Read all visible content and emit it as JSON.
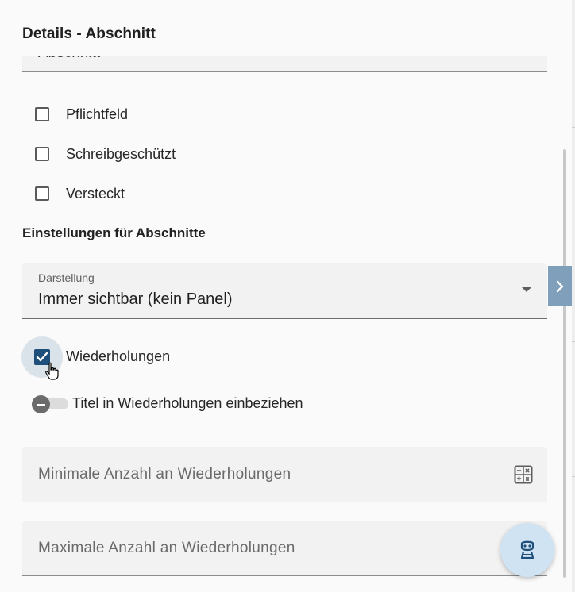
{
  "panel": {
    "title": "Details - Abschnitt"
  },
  "name_field": {
    "value": "Abschnitt"
  },
  "checkboxes": [
    {
      "label": "Pflichtfeld",
      "checked": false
    },
    {
      "label": "Schreibgeschützt",
      "checked": false
    },
    {
      "label": "Versteckt",
      "checked": false
    }
  ],
  "section": {
    "title": "Einstellungen für Abschnitte"
  },
  "display_select": {
    "label": "Darstellung",
    "value": "Immer sichtbar (kein Panel)"
  },
  "repeat": {
    "label": "Wiederholungen",
    "checked": true
  },
  "title_toggle": {
    "label": "Titel in Wiederholungen einbeziehen",
    "on": false
  },
  "min_field": {
    "placeholder": "Minimale Anzahl an Wiederholungen"
  },
  "max_field": {
    "placeholder": "Maximale Anzahl an Wiederholungen"
  },
  "icons": {
    "side_tab": "chevron-right-icon",
    "calculator": "calculator-icon",
    "assistant": "robot-assistant-icon",
    "cursor": "hand-pointer-icon"
  },
  "colors": {
    "accent": "#1e4f7a",
    "side_tab": "#7f9fba",
    "fab": "#cfe3f3",
    "field_bg": "#f2f2f2"
  }
}
